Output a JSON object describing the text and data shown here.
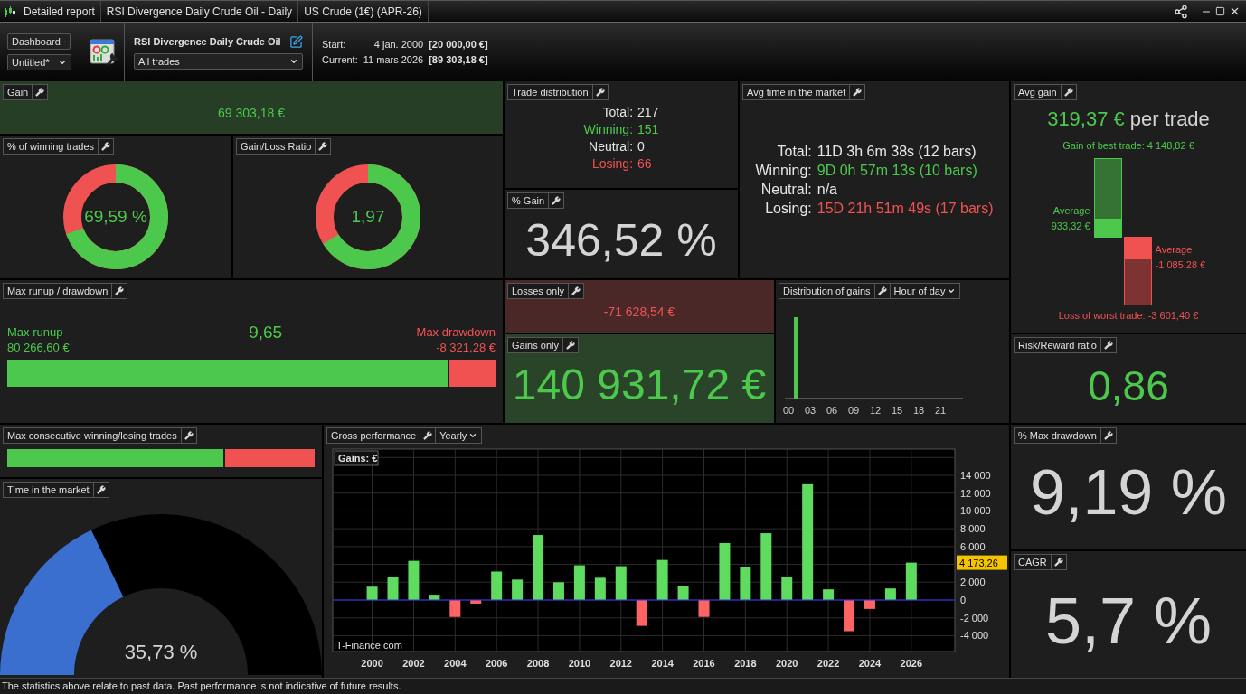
{
  "window": {
    "tabs": [
      "Detailed report",
      "RSI Divergence Daily Crude Oil - Daily",
      "US Crude (1€) (APR-26)"
    ]
  },
  "toolbar": {
    "view_select": "Dashboard",
    "layout_select": "Untitled*",
    "strategy_name": "RSI Divergence Daily Crude Oil",
    "trade_filter": "All trades",
    "start_label": "Start:",
    "start_date": "4 jan. 2000",
    "start_value": "[20 000,00 €]",
    "current_label": "Current:",
    "current_date": "11 mars 2026",
    "current_value": "[89 303,18 €]"
  },
  "panels": {
    "gain": {
      "title": "Gain",
      "value": "69 303,18 €"
    },
    "winning_trades": {
      "title": "% of winning trades",
      "value": "69,59 %",
      "level": 0.6959
    },
    "gain_loss_ratio": {
      "title": "Gain/Loss Ratio",
      "value": "1,97",
      "level": 0.663
    },
    "trade_distribution": {
      "title": "Trade distribution",
      "rows": [
        {
          "label": "Total:",
          "value": "217",
          "kind": "neutral"
        },
        {
          "label": "Winning:",
          "value": "151",
          "kind": "gain"
        },
        {
          "label": "Neutral:",
          "value": "0",
          "kind": "neutral"
        },
        {
          "label": "Losing:",
          "value": "66",
          "kind": "loss"
        }
      ]
    },
    "percent_gain": {
      "title": "% Gain",
      "value": "346,52 %"
    },
    "avg_time": {
      "title": "Avg time in the market",
      "rows": [
        {
          "label": "Total:",
          "value": "11D 3h 6m 38s (12 bars)",
          "kind": "neutral"
        },
        {
          "label": "Winning:",
          "value": "9D 0h 57m 13s (10 bars)",
          "kind": "gain"
        },
        {
          "label": "Neutral:",
          "value": "n/a",
          "kind": "neutral"
        },
        {
          "label": "Losing:",
          "value": "15D 21h 51m 49s (17 bars)",
          "kind": "loss"
        }
      ]
    },
    "avg_gain": {
      "title": "Avg gain",
      "value": "319,37 €",
      "suffix": "per trade",
      "best_label": "Gain of best trade: 4 148,82 €",
      "avg_gain_label": "Average",
      "avg_gain_value": "933,32 €",
      "avg_loss_label": "Average",
      "avg_loss_value": "-1 085,28 €",
      "worst_label": "Loss of worst trade: -3 601,40 €"
    },
    "max_runup": {
      "title": "Max runup / drawdown",
      "runup_label": "Max runup",
      "runup_value": "80 266,60 €",
      "ratio": "9,65",
      "drawdown_label": "Max drawdown",
      "drawdown_value": "-8 321,28 €",
      "level": 0.906
    },
    "losses_only": {
      "title": "Losses only",
      "value": "-71 628,54 €"
    },
    "gains_only": {
      "title": "Gains only",
      "value": "140 931,72 €"
    },
    "distribution_of_gains": {
      "title": "Distribution of gains",
      "period": "Hour of day",
      "hours": [
        "00",
        "03",
        "06",
        "09",
        "12",
        "15",
        "18",
        "21"
      ]
    },
    "risk_reward": {
      "title": "Risk/Reward ratio",
      "value": "0,86"
    },
    "max_consecutive": {
      "title": "Max consecutive winning/losing trades",
      "level": 0.71
    },
    "time_in_market": {
      "title": "Time in the market",
      "value": "35,73 %",
      "level": 0.3573
    },
    "gross_performance": {
      "title": "Gross performance",
      "period": "Yearly",
      "credit": "IT-Finance.com",
      "last_value_tag": "4 173,26",
      "chart_data": {
        "type": "bar",
        "title": "Gains: €",
        "grid": true,
        "x": [
          2000,
          2001,
          2002,
          2003,
          2004,
          2005,
          2006,
          2007,
          2008,
          2009,
          2010,
          2011,
          2012,
          2013,
          2014,
          2015,
          2016,
          2017,
          2018,
          2019,
          2020,
          2021,
          2022,
          2023,
          2024,
          2025,
          2026
        ],
        "series": [
          {
            "color": "#5fdc5f",
            "values": [
              1500,
              2600,
              4400,
              600,
              null,
              null,
              3200,
              2300,
              7300,
              2000,
              3900,
              2500,
              3800,
              null,
              4500,
              1600,
              null,
              6400,
              3700,
              7500,
              2600,
              13000,
              1200,
              null,
              null,
              1300,
              4200
            ]
          },
          {
            "color": "#ff6464",
            "values": [
              null,
              null,
              null,
              null,
              -1900,
              -400,
              null,
              null,
              null,
              null,
              null,
              null,
              null,
              -2900,
              null,
              null,
              -1900,
              null,
              null,
              null,
              null,
              null,
              null,
              -3500,
              -1000,
              null,
              null
            ]
          }
        ],
        "xlim": [
          1998.1,
          2028.1
        ],
        "ylim": [
          -5780,
          16940
        ],
        "xticks": [
          2000,
          2002,
          2004,
          2006,
          2008,
          2010,
          2012,
          2014,
          2016,
          2018,
          2020,
          2022,
          2024,
          2026
        ],
        "yticks": [
          {
            "value": 14000,
            "label": "14 000"
          },
          {
            "value": 12000,
            "label": "12 000"
          },
          {
            "value": 10000,
            "label": "10 000"
          },
          {
            "value": 8000,
            "label": "8 000"
          },
          {
            "value": 6000,
            "label": "6 000"
          },
          {
            "value": 2000,
            "label": "2 000"
          },
          {
            "value": 0,
            "label": "0"
          },
          {
            "value": -2000,
            "label": "-2 000"
          },
          {
            "value": -4000,
            "label": "-4 000"
          }
        ],
        "ref_lines": [
          {
            "axis": "y",
            "value": 0,
            "color": "#3030ff"
          }
        ]
      }
    },
    "max_drawdown_pct": {
      "title": "% Max drawdown",
      "value": "9,19 %"
    },
    "cagr": {
      "title": "CAGR",
      "value": "5,7 %"
    }
  },
  "status_bar": {
    "text": "The statistics above relate to past data. Past performance is not indicative of future results."
  }
}
